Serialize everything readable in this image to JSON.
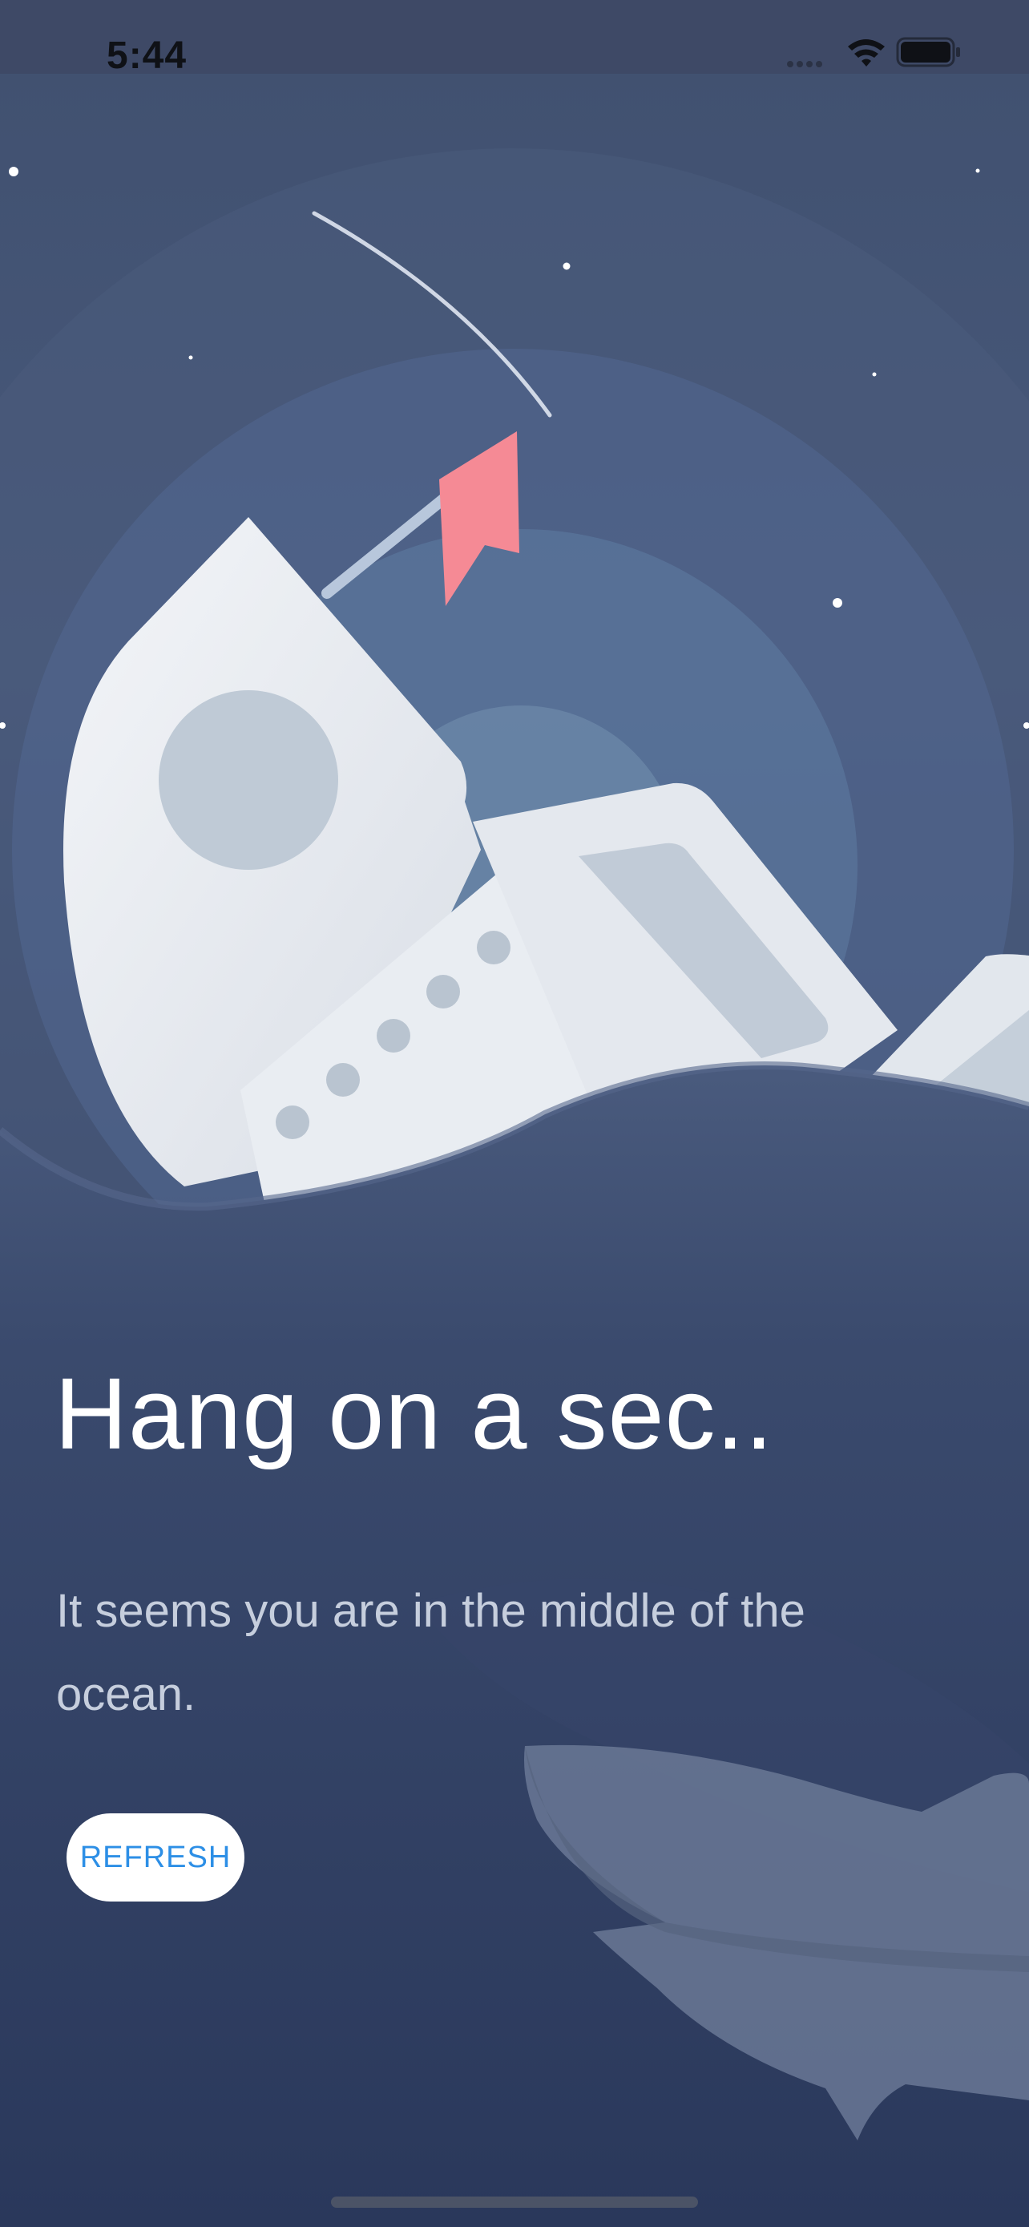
{
  "status_bar": {
    "time": "5:44",
    "icons": [
      "signal-dots-icon",
      "wifi-icon",
      "battery-icon"
    ]
  },
  "illustration": {
    "description_icons": [
      "shooting-star-icon",
      "sinking-ship-icon",
      "red-flag-icon",
      "shark-icon"
    ],
    "colors": {
      "sky": "#48597b",
      "sea": "#2b3a5e",
      "ship": "#e8ecf1",
      "flag": "#f58a95"
    }
  },
  "content": {
    "headline": "Hang on a sec..",
    "message": "It seems you are in the middle of the ocean.",
    "refresh_label": "REFRESH"
  },
  "colors": {
    "accent": "#2d8fe6",
    "text_primary": "#ffffff",
    "text_secondary": "#c6cedd"
  }
}
